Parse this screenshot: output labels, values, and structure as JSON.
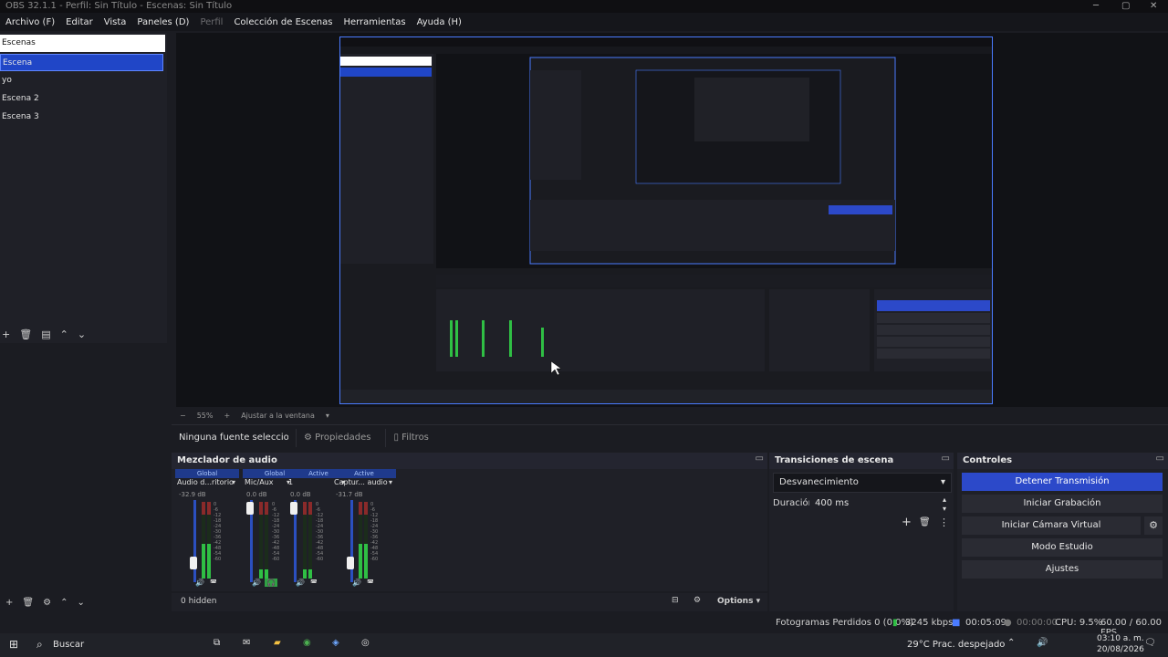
{
  "window": {
    "title": "OBS 32.1.1 - Perfil: Sin Título - Escenas: Sin Título"
  },
  "menu": [
    "Archivo (F)",
    "Editar",
    "Vista",
    "Paneles (D)",
    "Perfil",
    "Colección de Escenas",
    "Herramientas",
    "Ayuda (H)"
  ],
  "scenes": {
    "header": "Escenas",
    "items": [
      "Escena",
      "yo",
      "Escena 2",
      "Escena 3"
    ],
    "selected": "Escena"
  },
  "zoom": {
    "percent": "55%",
    "fit_label": "Ajustar a la ventana"
  },
  "source_bar": {
    "no_source": "Ninguna fuente seleccionada",
    "properties": "Propiedades",
    "filters": "Filtros"
  },
  "mixer": {
    "title": "Mezclador de audio",
    "channels": [
      {
        "tag": "Global",
        "name": "Audio d...ritorio",
        "db": "-32.9 dB",
        "level": 0.45
      },
      {
        "tag": "Global",
        "name": "Mic/Aux",
        "db": "0.0 dB",
        "level": 0.9
      },
      {
        "tag": "Active",
        "name": "1",
        "db": "0.0 dB",
        "level": 0.9
      },
      {
        "tag": "Active",
        "name": "Captur... audio",
        "db": "-31.7 dB",
        "level": 0.45
      }
    ],
    "scale": [
      "0",
      "-6",
      "-12",
      "-18",
      "-24",
      "-30",
      "-36",
      "-42",
      "-48",
      "-54",
      "-60"
    ],
    "hidden_label": "0 hidden",
    "options_label": "Options"
  },
  "transitions": {
    "title": "Transiciones de escena",
    "selected": "Desvanecimiento",
    "duration_label": "Duración",
    "duration_value": "400 ms"
  },
  "controls": {
    "title": "Controles",
    "buttons": [
      "Detener Transmisión",
      "Iniciar Grabación",
      "Iniciar Cámara Virtual",
      "Modo Estudio",
      "Ajustes"
    ]
  },
  "status": {
    "dropped": "Fotogramas Perdidos 0 (0,0%)",
    "bitrate": "3245 kbps",
    "stream_time": "00:05:09",
    "record_time": "00:00:00",
    "cpu": "CPU: 9.5%",
    "fps": "60.00 / 60.00 FPS"
  },
  "taskbar": {
    "search": "Buscar",
    "weather": "29°C Prac. despejado",
    "time": "03:10 a. m.",
    "date": "20/08/2026"
  },
  "colors": {
    "accent": "#2c49c9",
    "selection": "#2046c7"
  }
}
